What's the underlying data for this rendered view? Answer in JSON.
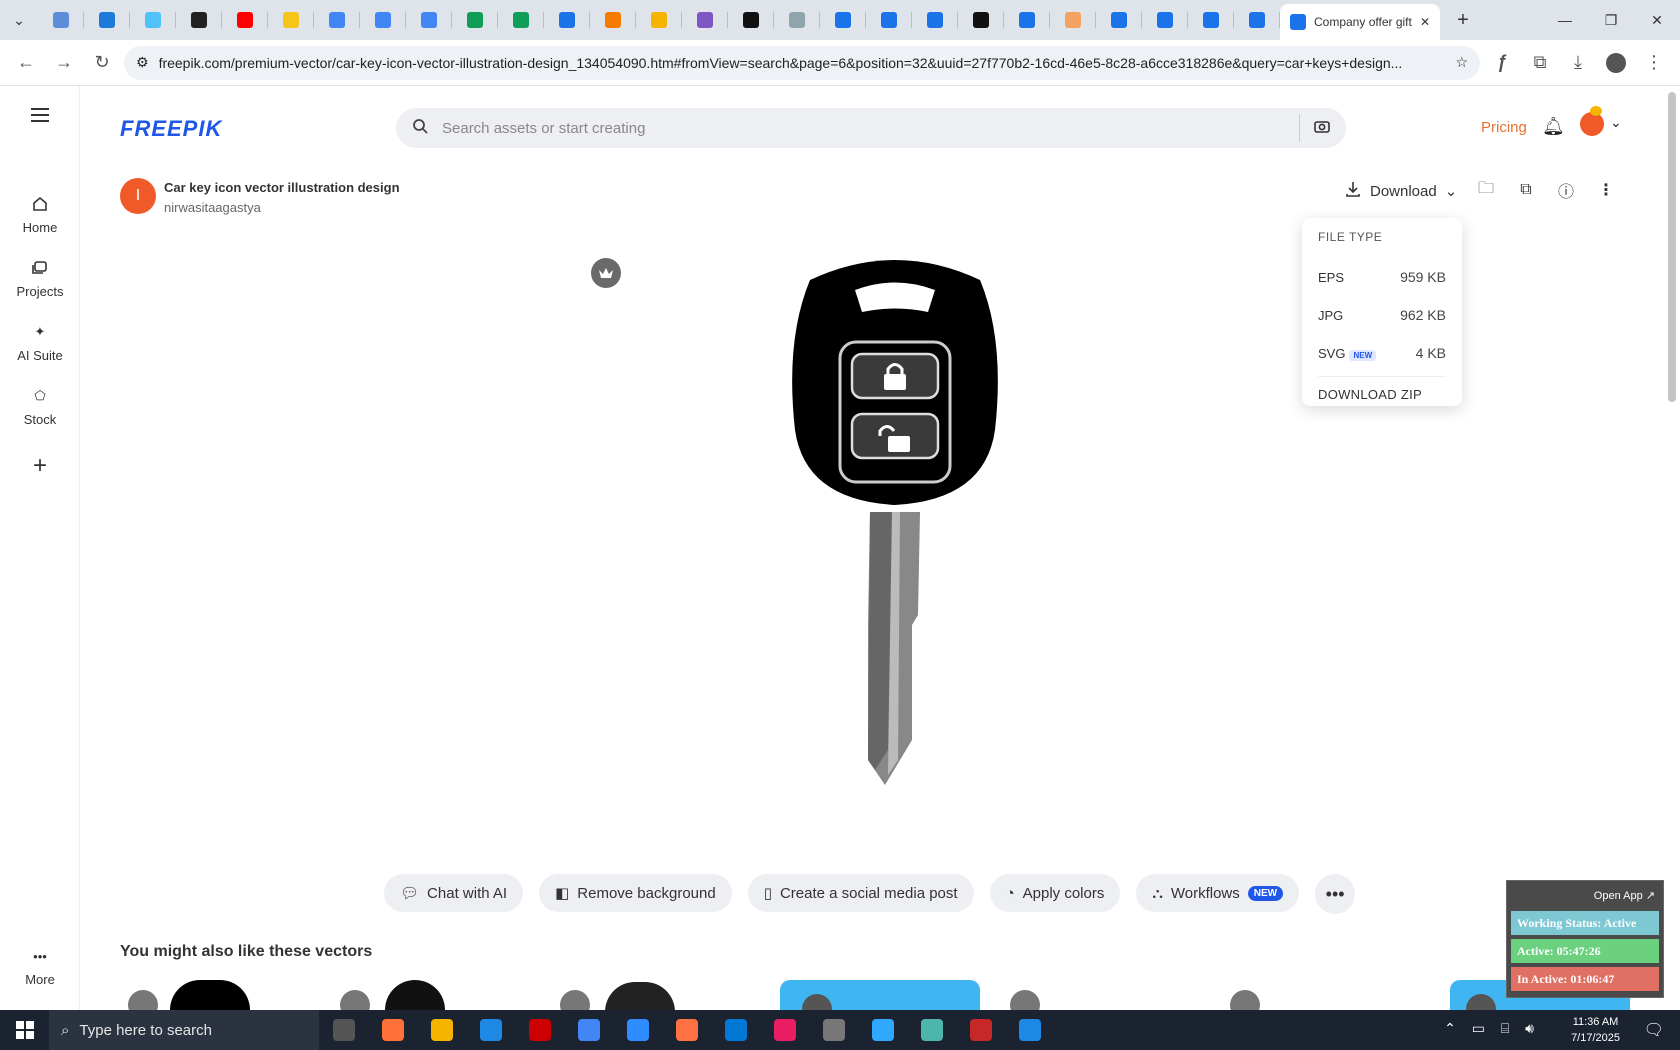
{
  "browser": {
    "tab_icons": [
      "#5b8dd9",
      "#1e7ad9",
      "#4fc3f7",
      "#222",
      "#ff0000",
      "#f5c518",
      "#4285f4",
      "#4285f4",
      "#4285f4",
      "#0f9d58",
      "#0f9d58",
      "#1a73e8",
      "#f57c00",
      "#f4b400",
      "#7e57c2",
      "#111",
      "#90a4ae",
      "#1a73e8",
      "#1a73e8",
      "#1a73e8",
      "#111",
      "#1a73e8",
      "#f4a261",
      "#1a73e8",
      "#1a73e8",
      "#1a73e8",
      "#1a73e8"
    ],
    "active_tab_title": "Company offer gift c",
    "url": "freepik.com/premium-vector/car-key-icon-vector-illustration-design_134054090.htm#fromView=search&page=6&position=32&uuid=27f770b2-16cd-46e5-8c28-a6cce318286e&query=car+keys+design..."
  },
  "header": {
    "logo": "FREEPIK",
    "search_placeholder": "Search assets or start creating",
    "pricing": "Pricing"
  },
  "sidebar": {
    "items": [
      {
        "label": "Home"
      },
      {
        "label": "Projects"
      },
      {
        "label": "AI Suite"
      },
      {
        "label": "Stock"
      }
    ],
    "more": "More"
  },
  "asset": {
    "avatar_letter": "I",
    "title": "Car key icon vector illustration design",
    "author": "nirwasitaagastya"
  },
  "download": {
    "label": "Download",
    "file_type_header": "FILE TYPE",
    "files": [
      {
        "type": "EPS",
        "size": "959 KB",
        "badge": ""
      },
      {
        "type": "JPG",
        "size": "962 KB",
        "badge": ""
      },
      {
        "type": "SVG",
        "size": "4 KB",
        "badge": "NEW"
      }
    ],
    "zip": "DOWNLOAD ZIP"
  },
  "actions": {
    "chat": "Chat with AI",
    "remove_bg": "Remove background",
    "social": "Create a social media post",
    "colors": "Apply colors",
    "workflows": "Workflows",
    "workflows_badge": "NEW"
  },
  "related": {
    "title": "You might also like these vectors"
  },
  "widget": {
    "open_app": "Open App ↗",
    "status": "Working Status: Active",
    "active": "Active: 05:47:26",
    "inactive": "In Active: 01:06:47",
    "status_color": "#7ec8d4",
    "active_color": "#6bd17f",
    "inactive_color": "#e07064"
  },
  "taskbar": {
    "search_placeholder": "Type here to search",
    "apps": [
      "#555",
      "#ff7139",
      "#f4b400",
      "#1e88e5",
      "#cc0000",
      "#4285f4",
      "#2d8cff",
      "#ff7043",
      "#0078d4",
      "#e91e63",
      "#777",
      "#31a8ff",
      "#4db6ac",
      "#c62828",
      "#1e88e5"
    ],
    "time": "11:36 AM",
    "date": "7/17/2025"
  }
}
